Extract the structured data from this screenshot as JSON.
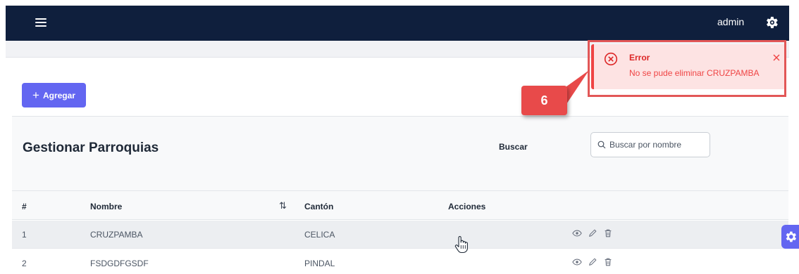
{
  "header": {
    "menu_icon": "hamburger-menu-icon",
    "username": "admin",
    "settings_icon": "gear-icon",
    "background": "#0f1f3d"
  },
  "toolbar": {
    "add_label": "Agregar",
    "add_color": "#6366f1"
  },
  "panel": {
    "title": "Gestionar Parroquias",
    "search_label": "Buscar",
    "search_placeholder": "Buscar por nombre",
    "search_value": ""
  },
  "table": {
    "columns": [
      "#",
      "Nombre",
      "Cantón",
      "Acciones"
    ],
    "rows": [
      {
        "index": "1",
        "nombre": "CRUZPAMBA",
        "canton": "CELICA",
        "actions": [
          "view-icon",
          "edit-icon",
          "delete-icon"
        ]
      },
      {
        "index": "2",
        "nombre": "FSDGDFGSDF",
        "canton": "PINDAL",
        "actions": [
          "view-icon",
          "edit-icon",
          "delete-icon"
        ]
      }
    ]
  },
  "toast": {
    "title": "Error",
    "message": "No se pude eliminar CRUZPAMBA",
    "severity": "error",
    "color": "#ef4444"
  },
  "annotation": {
    "step": "6",
    "color": "#e84a4a"
  }
}
